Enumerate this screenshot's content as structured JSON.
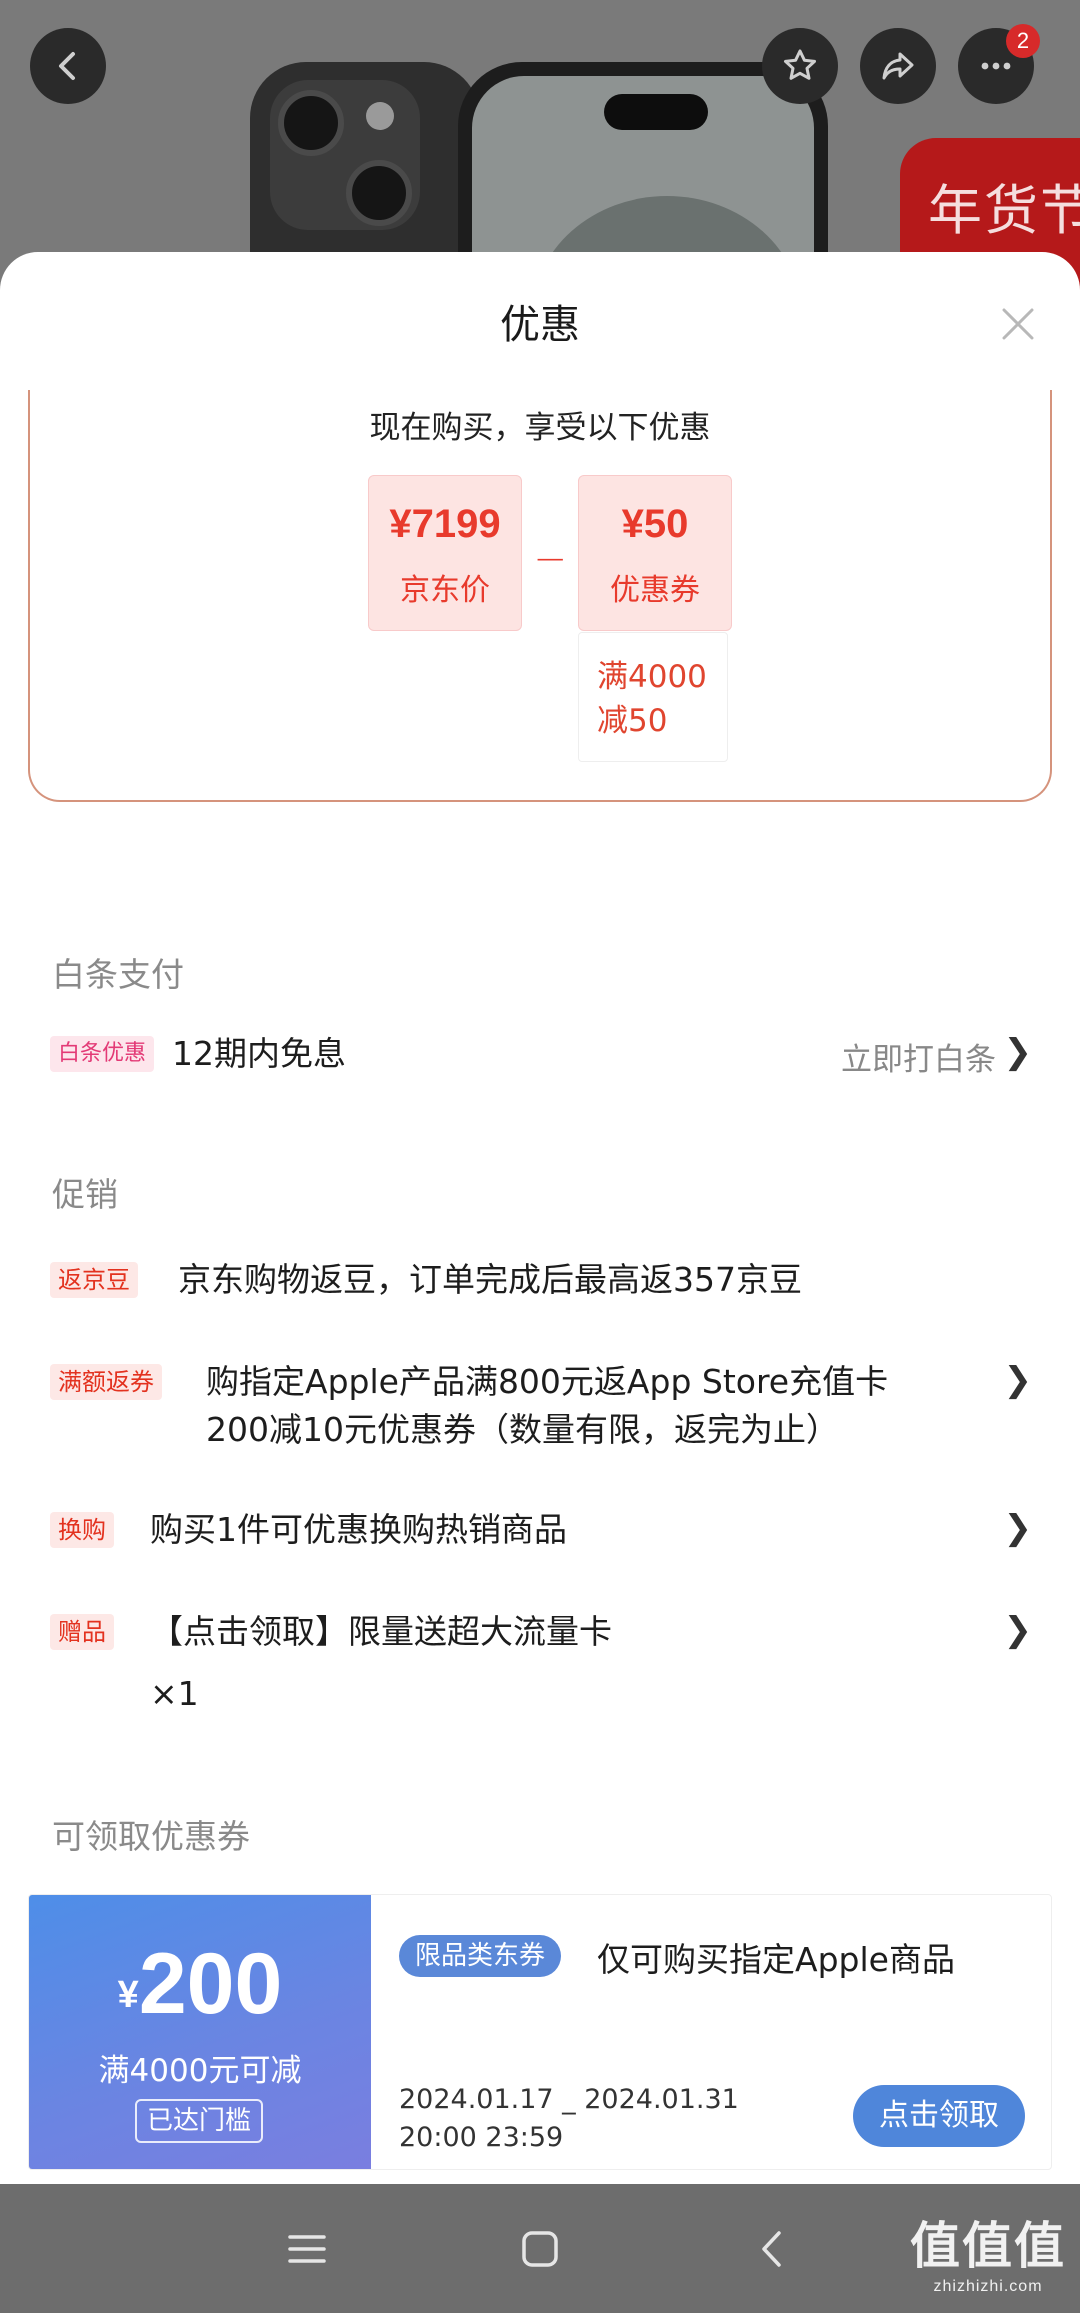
{
  "background": {
    "promo_badge": "年货节",
    "notification_count": "2"
  },
  "sheet": {
    "title": "优惠"
  },
  "offer": {
    "heading": "现在购买，享受以下优惠",
    "jd_price": "¥7199",
    "jd_price_label": "京东价",
    "operator": "_",
    "coupon_amount": "¥50",
    "coupon_label": "优惠券",
    "coupon_condition_line1": "满4000",
    "coupon_condition_line2": "减50"
  },
  "baitiao": {
    "section_title": "白条支付",
    "tag": "白条优惠",
    "text": "12期内免息",
    "link": "立即打白条"
  },
  "promotions": {
    "section_title": "促销",
    "items": [
      {
        "tag": "返京豆",
        "text_line1": "京东购物返豆，订单完成后最高返357京豆",
        "text_line2": ""
      },
      {
        "tag": "满额返券",
        "text_line1": "购指定Apple产品满800元返App Store充值卡",
        "text_line2": "200减10元优惠券（数量有限，返完为止）"
      },
      {
        "tag": "换购",
        "text_line1": "购买1件可优惠换购热销商品",
        "text_line2": ""
      },
      {
        "tag": "赠品",
        "text_line1": "【点击领取】限量送超大流量卡",
        "text_line2": "×1"
      }
    ]
  },
  "coupons": {
    "section_title": "可领取优惠券",
    "items": [
      {
        "currency": "¥",
        "amount": "200",
        "condition": "满4000元可减",
        "badge": "已达门槛",
        "type": "限品类东券",
        "description": "仅可购买指定Apple商品",
        "date_line1": "2024.01.17 _ 2024.01.31",
        "date_line2": "20:00 23:59",
        "action": "点击领取"
      }
    ]
  },
  "watermark": {
    "main": "值值值",
    "sub": "zhizhizhi.com"
  },
  "colors": {
    "accent_red": "#e3321f",
    "coupon_blue": "#4f86da",
    "card_border": "#d5937c"
  }
}
